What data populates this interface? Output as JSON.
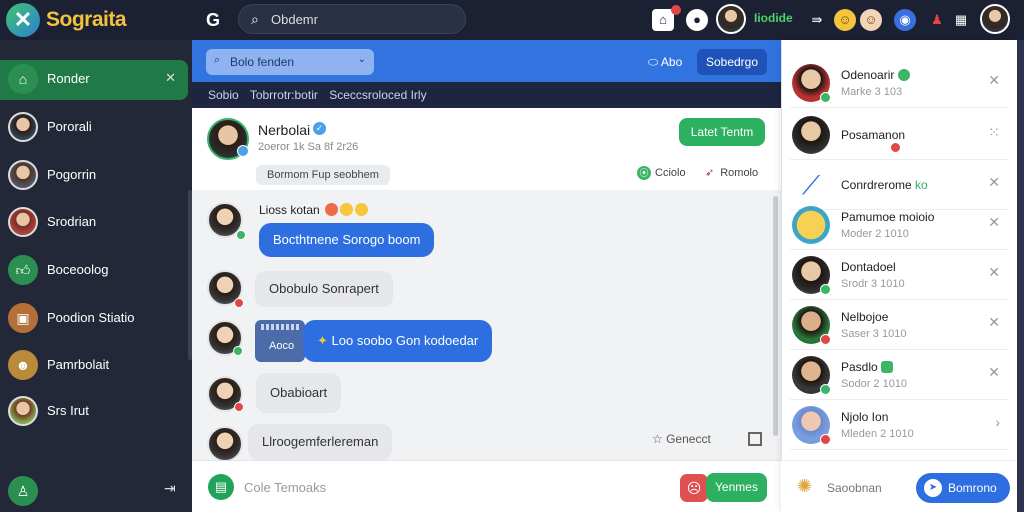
{
  "app": {
    "brand": "Sograita",
    "logo_glyph": "✕"
  },
  "topbar": {
    "search_placeholder": "Obdemr",
    "status_text": "Iiodide",
    "icons": [
      "g-icon",
      "home-icon",
      "record-icon",
      "forward-icon",
      "emoji-icon",
      "globe-icon",
      "bell-icon",
      "grid-icon"
    ]
  },
  "sidebar": {
    "items": [
      {
        "label": "Ronder",
        "icon": "home-icon",
        "active": true
      },
      {
        "label": "Pororali"
      },
      {
        "label": "Pogorrin"
      },
      {
        "label": "Srodrian"
      },
      {
        "label": "Boceoolog"
      },
      {
        "label": "Poodion Stiatio"
      },
      {
        "label": "Pamrbolait"
      },
      {
        "label": "Srs Irut"
      }
    ],
    "close_glyph": "✕",
    "footer_arrow": "⇥"
  },
  "header": {
    "channel_select": "Bolo fenden",
    "about": "Abo",
    "subscribe": "Sobedrgo",
    "subbar": [
      "Sobio",
      "Tobrrotr:botir",
      "Sceccsroloced Irly"
    ]
  },
  "chat": {
    "name": "Nerbolai",
    "subtitle": "2oeror 1k Sa 8f 2r26",
    "chip": "Bormom Fup seobhem",
    "latest_button": "Latet Tentm",
    "online_label": "Cciolo",
    "remote_label": "Romolo"
  },
  "messages": [
    {
      "sender": "Lioss kotan",
      "text": "Bocthtnene Sorogo boom",
      "style": "blue",
      "status_color": "#3bb566"
    },
    {
      "text": "Obobulo Sonrapert",
      "style": "white",
      "status_color": "#e04848"
    },
    {
      "quote": "Aoco",
      "text": "Loo soobo Gon kodoedar",
      "style": "blue",
      "status_color": "#3bb566"
    },
    {
      "text": "Obabioart",
      "style": "white",
      "status_color": "#e04848"
    },
    {
      "text": "Llroogemferlereman",
      "style": "white",
      "status_color": "#e04848"
    }
  ],
  "messages_footer": {
    "generic": "Genecct"
  },
  "composer": {
    "placeholder": "Cole Temoaks",
    "send": "Yenmes"
  },
  "right_panel": {
    "contacts": [
      {
        "name": "Odenoarir",
        "sub": "Marke 3 103",
        "action": "✕",
        "status_color": "#3bb566"
      },
      {
        "name": "Posamanon",
        "sub": "",
        "action": "⁙",
        "status_color": "#e04848"
      },
      {
        "name": "Conrdrerome",
        "name_tag": "ko",
        "sub": "",
        "action": "✕",
        "status_color": ""
      },
      {
        "name": "Pamumoe moioio",
        "sub": "Moder 2 1010",
        "action": "✕",
        "status_color": ""
      },
      {
        "name": "Dontadoel",
        "sub": "Srodr 3 1010",
        "action": "✕",
        "status_color": "#3bb566"
      },
      {
        "name": "Nelbojoe",
        "sub": "Saser 3 1010",
        "action": "✕",
        "status_color": "#e04848"
      },
      {
        "name": "Pasdlo",
        "sub": "Sodor 2 1010",
        "action": "✕",
        "status_color": "#3bb566"
      },
      {
        "name": "Njolo Ion",
        "sub": "Mleden 2 1010",
        "action": "›",
        "status_color": "#e04848"
      }
    ],
    "footer_label": "Saoobnan",
    "footer_button": "Bomrono"
  },
  "colors": {
    "accent_blue": "#3174e0",
    "accent_green": "#2eb061",
    "sidebar_bg": "#232838",
    "topbar_bg": "#1b2032"
  }
}
